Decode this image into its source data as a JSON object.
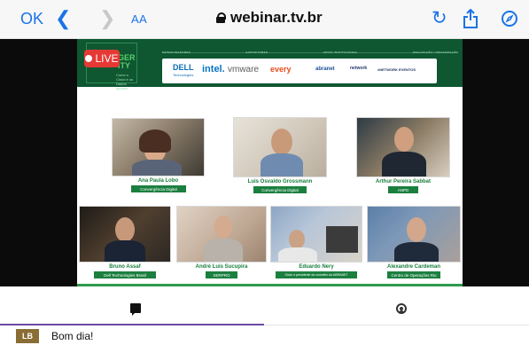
{
  "browser": {
    "ok_label": "OK",
    "text_size_label": "AA",
    "url": "webinar.tv.br"
  },
  "stream": {
    "live_label": "LIVE",
    "event_logo": {
      "title": "GER\nITY",
      "subtitle": "Como o Cloud e os Dados ajudam"
    },
    "sponsor_categories": [
      "PATROCINADORES",
      "EXPOSITORES",
      "APOIO INSTITUCIONAL",
      "REALIZAÇÃO / ORGANIZAÇÃO"
    ],
    "sponsors": [
      {
        "label": "DELL",
        "sub": "Technologies",
        "color": "#0b6db7"
      },
      {
        "label": "intel.",
        "color": "#0a74c2"
      },
      {
        "label": "vmware",
        "color": "#5d5d5d"
      },
      {
        "label": "every",
        "color": "#e84d1c"
      },
      {
        "label": "abranet",
        "color": "#1c4f94"
      },
      {
        "label": "network",
        "color": "#243a70"
      },
      {
        "label": "#NETWORK EVENTOS",
        "color": "#1e3360"
      }
    ],
    "speakers": [
      {
        "name": "Ana Paula Lobo",
        "org": "Convergência Digital"
      },
      {
        "name": "Luis Osvaldo Grossmann",
        "org": "Convergência Digital"
      },
      {
        "name": "Arthur Pereira Sabbat",
        "org": "ANPD"
      },
      {
        "name": "Bruno Assaf",
        "org": "Dell Technologies Brasil"
      },
      {
        "name": "André Luis Sucupira",
        "org": "SERPRO"
      },
      {
        "name": "Eduardo Nery",
        "org": "Sócio e presidente do conselho da ABRANET"
      },
      {
        "name": "Alexandre Cardeman",
        "org": "Centro de Operações Rio"
      }
    ]
  },
  "tabs": [
    {
      "name": "chat",
      "icon": "chat-icon",
      "active": true
    },
    {
      "name": "profile",
      "icon": "user-icon",
      "active": false
    }
  ],
  "message": {
    "avatar_initials": "LB",
    "text": "Bom dia!"
  },
  "colors": {
    "accent_blue": "#1a73e8",
    "banner_green": "#0e5731",
    "speaker_green": "#187e3d",
    "live_red": "#e53935",
    "tab_active": "#6b4aa3"
  }
}
